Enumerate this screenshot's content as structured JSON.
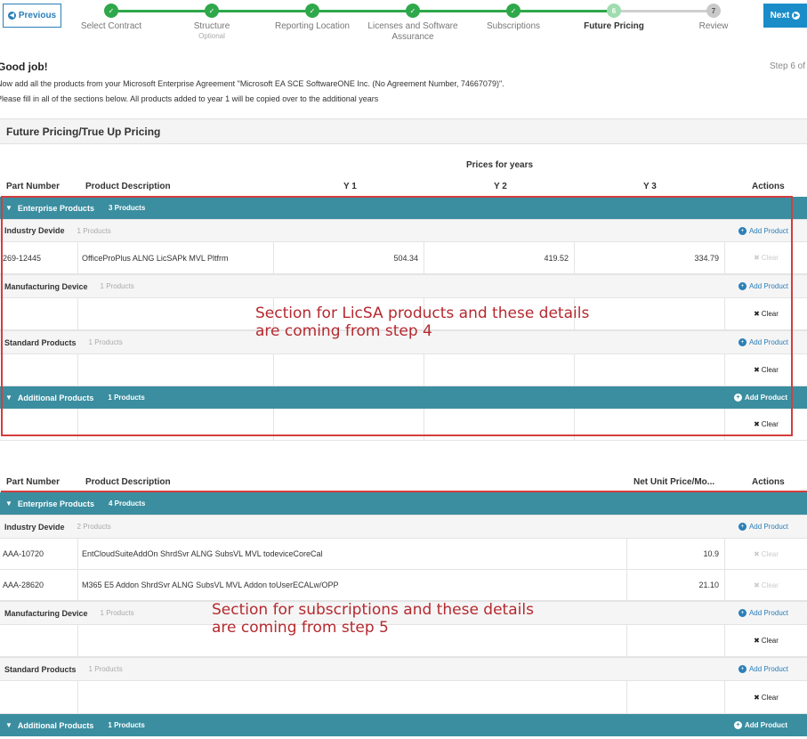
{
  "nav": {
    "previous_label": "Previous",
    "next_label": "Next"
  },
  "steps": [
    {
      "number": "1",
      "label": "Select Contract",
      "sublabel": "",
      "status": "done"
    },
    {
      "number": "2",
      "label": "Structure",
      "sublabel": "Optional",
      "status": "done"
    },
    {
      "number": "3",
      "label": "Reporting Location",
      "sublabel": "",
      "status": "done"
    },
    {
      "number": "4",
      "label": "Licenses and Software Assurance",
      "sublabel": "",
      "status": "done"
    },
    {
      "number": "5",
      "label": "Subscriptions",
      "sublabel": "",
      "status": "done"
    },
    {
      "number": "6",
      "label": "Future Pricing",
      "sublabel": "",
      "status": "current"
    },
    {
      "number": "7",
      "label": "Review",
      "sublabel": "",
      "status": "todo"
    }
  ],
  "intro": {
    "heading": "Good job!",
    "step_of": "Step 6 of",
    "line1": "Now add all the products from your Microsoft Enterprise Agreement \"Microsoft EA SCE SoftwareONE Inc. (No Agreement Number, 74667079)\".",
    "line2": "Please fill in all of the sections below. All products added to year 1 will be copied over to the additional years"
  },
  "section_title": "Future Pricing/True Up Pricing",
  "licsa_table": {
    "prices_header": "Prices for years",
    "columns": {
      "part_number": "Part Number",
      "description": "Product Description",
      "y1": "Y 1",
      "y2": "Y 2",
      "y3": "Y 3",
      "actions": "Actions"
    },
    "enterprise": {
      "name": "Enterprise Products",
      "count": "3 Products"
    },
    "groups": [
      {
        "name": "Industry Devide",
        "count": "1 Products",
        "add_label": "Add Product"
      },
      {
        "name": "Manufacturing Device",
        "count": "1 Products",
        "add_label": "Add Product"
      },
      {
        "name": "Standard Products",
        "count": "1 Products",
        "add_label": "Add Product"
      }
    ],
    "rows": [
      {
        "part": "269-12445",
        "description": "OfficeProPlus ALNG LicSAPk MVL Pltfrm",
        "y1": "504.34",
        "y2": "419.52",
        "y3": "334.79",
        "action": "Clear"
      },
      {
        "action": "Clear"
      },
      {
        "action": "Clear"
      },
      {
        "action": "Clear"
      }
    ],
    "additional": {
      "name": "Additional Products",
      "count": "1 Products",
      "add_label": "Add Product"
    }
  },
  "subs_table": {
    "columns": {
      "part_number": "Part Number",
      "description": "Product Description",
      "net_price": "Net Unit Price/Mo...",
      "actions": "Actions"
    },
    "enterprise": {
      "name": "Enterprise Products",
      "count": "4 Products"
    },
    "groups": [
      {
        "name": "Industry Devide",
        "count": "2 Products",
        "add_label": "Add Product"
      },
      {
        "name": "Manufacturing Device",
        "count": "1 Products",
        "add_label": "Add Product"
      },
      {
        "name": "Standard Products",
        "count": "1 Products",
        "add_label": "Add Product"
      }
    ],
    "rows": [
      {
        "part": "AAA-10720",
        "description": "EntCloudSuiteAddOn ShrdSvr ALNG SubsVL MVL todeviceCoreCal",
        "price": "10.9",
        "action": "Clear"
      },
      {
        "part": "AAA-28620",
        "description": "M365 E5 Addon ShrdSvr ALNG SubsVL MVL Addon toUserECALw/OPP",
        "price": "21.10",
        "action": "Clear"
      },
      {
        "action": "Clear"
      },
      {
        "action": "Clear"
      }
    ],
    "additional": {
      "name": "Additional Products",
      "count": "1 Products",
      "add_label": "Add Product"
    }
  },
  "annotations": {
    "licsa_line1": "Section for LicSA products and these details",
    "licsa_line2": "are coming from step 4",
    "subs_line1": "Section for subscriptions and these details",
    "subs_line2": "are coming from step 5"
  },
  "colors": {
    "accent": "#1a8dc9",
    "teal_band": "#3a8ea0",
    "step_done": "#2ea84a",
    "annotation": "#d43d3d"
  }
}
